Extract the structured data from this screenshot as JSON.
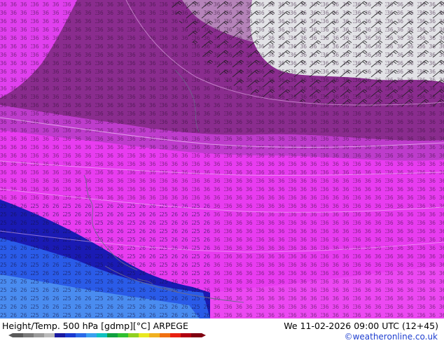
{
  "footer": {
    "title": "Height/Temp. 500 hPa [gdmp][°C] ARPEGE",
    "valid_time": "We 11-02-2026 09:00 UTC (12+45)",
    "credit": "©weatheronline.co.uk"
  },
  "colors": {
    "background_magenta": "#e83cf0",
    "dark_purple": "#8a2c8e",
    "mid_purple": "#b03cc0",
    "pale_gray": "#e2e2e6",
    "dark_blue": "#1a1ab4",
    "medium_blue": "#2a5be8",
    "light_blue": "#4a8cf0",
    "footer_text": "#000000",
    "credit_text": "#1f3fd0"
  },
  "colorbar": {
    "colors": [
      "#5a5a5a",
      "#7a7a7a",
      "#9a9a9a",
      "#bababa",
      "#1a1aa0",
      "#1a3ad0",
      "#2a6ae8",
      "#3aa0f0",
      "#10c0c0",
      "#10a040",
      "#30c030",
      "#90d020",
      "#e8e820",
      "#f0b020",
      "#f07010",
      "#e82010",
      "#b00010",
      "#800010"
    ]
  }
}
